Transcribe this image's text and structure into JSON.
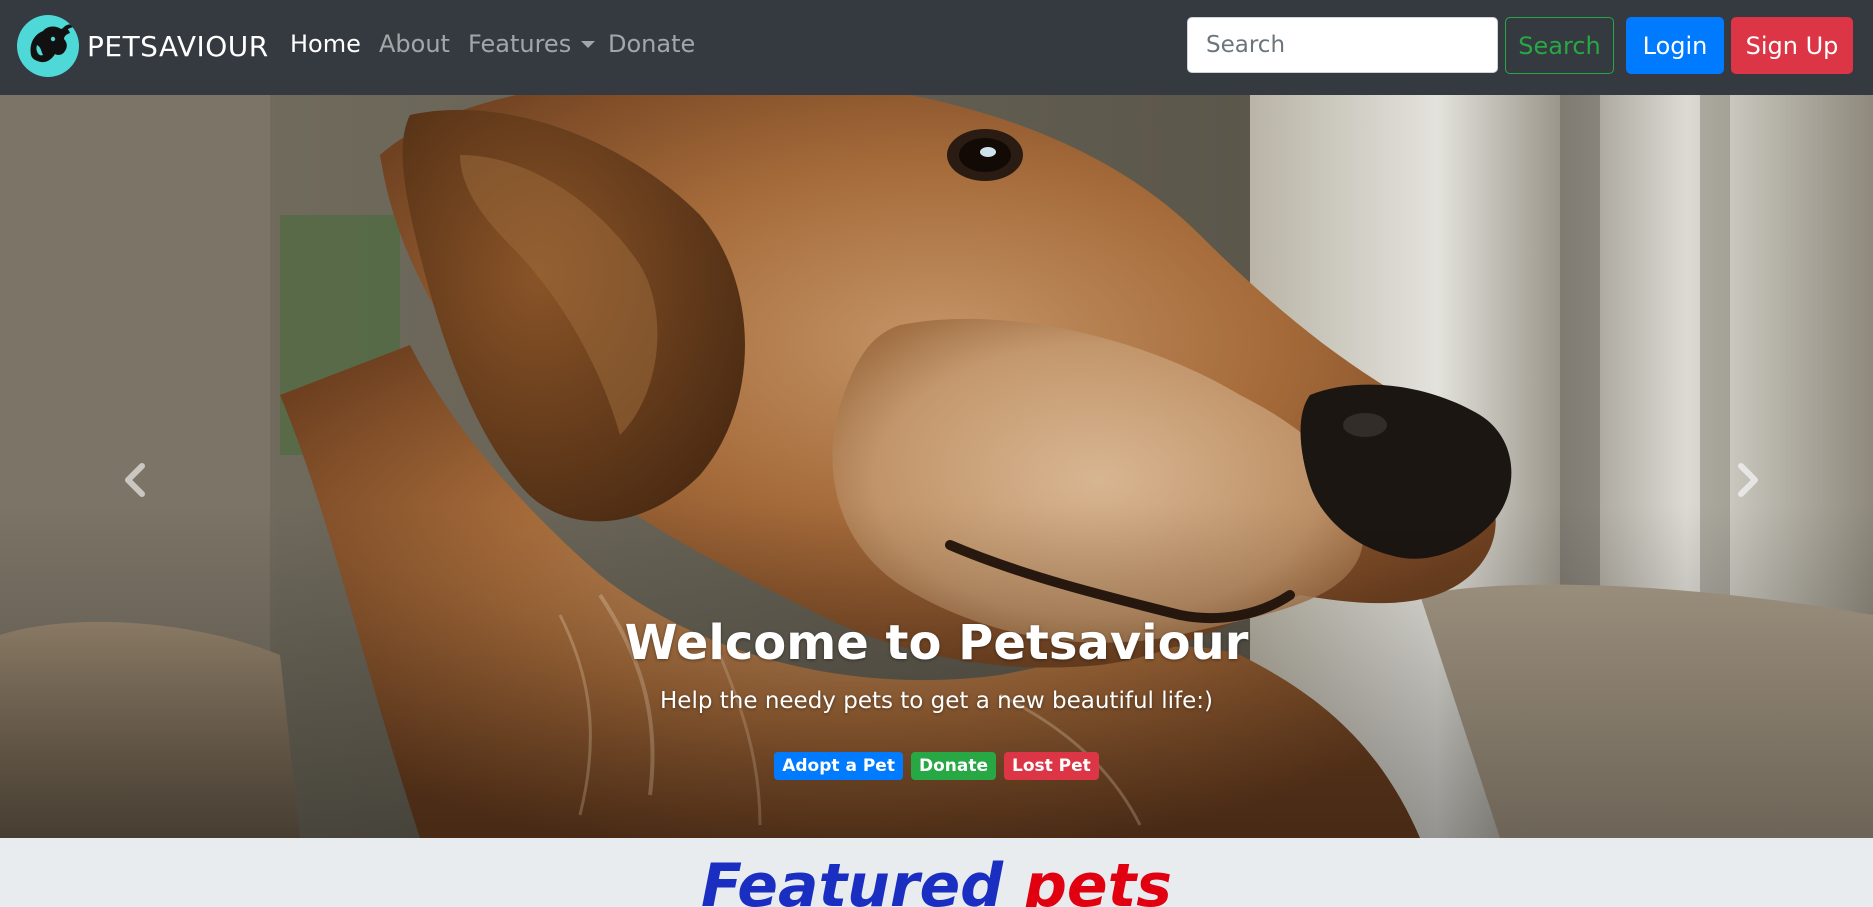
{
  "brand": {
    "name": "PETSAVIOUR",
    "logo_icon": "dog-head-icon",
    "logo_color": "#4fd8d8"
  },
  "nav": {
    "links": [
      {
        "label": "Home",
        "active": true
      },
      {
        "label": "About",
        "active": false
      },
      {
        "label": "Features",
        "active": false,
        "dropdown": true
      },
      {
        "label": "Donate",
        "active": false
      }
    ]
  },
  "search": {
    "placeholder": "Search",
    "value": "",
    "button_label": "Search"
  },
  "auth": {
    "login_label": "Login",
    "signup_label": "Sign Up"
  },
  "hero": {
    "image": "golden retriever photo",
    "title": "Welcome to Petsaviour",
    "subtitle": "Help the needy pets to get a new beautiful life:)",
    "badges": [
      {
        "label": "Adopt a Pet",
        "color": "#007bff"
      },
      {
        "label": "Donate",
        "color": "#28a745"
      },
      {
        "label": "Lost Pet",
        "color": "#dc3545"
      }
    ],
    "prev_icon": "chevron-left-icon",
    "next_icon": "chevron-right-icon"
  },
  "featured": {
    "word1": "Featured",
    "word2": "pets"
  },
  "colors": {
    "navbar_bg": "#343a40",
    "primary": "#007bff",
    "success": "#28a745",
    "danger": "#dc3545",
    "featured_blue": "#1a2fc2",
    "featured_red": "#e0000f"
  }
}
